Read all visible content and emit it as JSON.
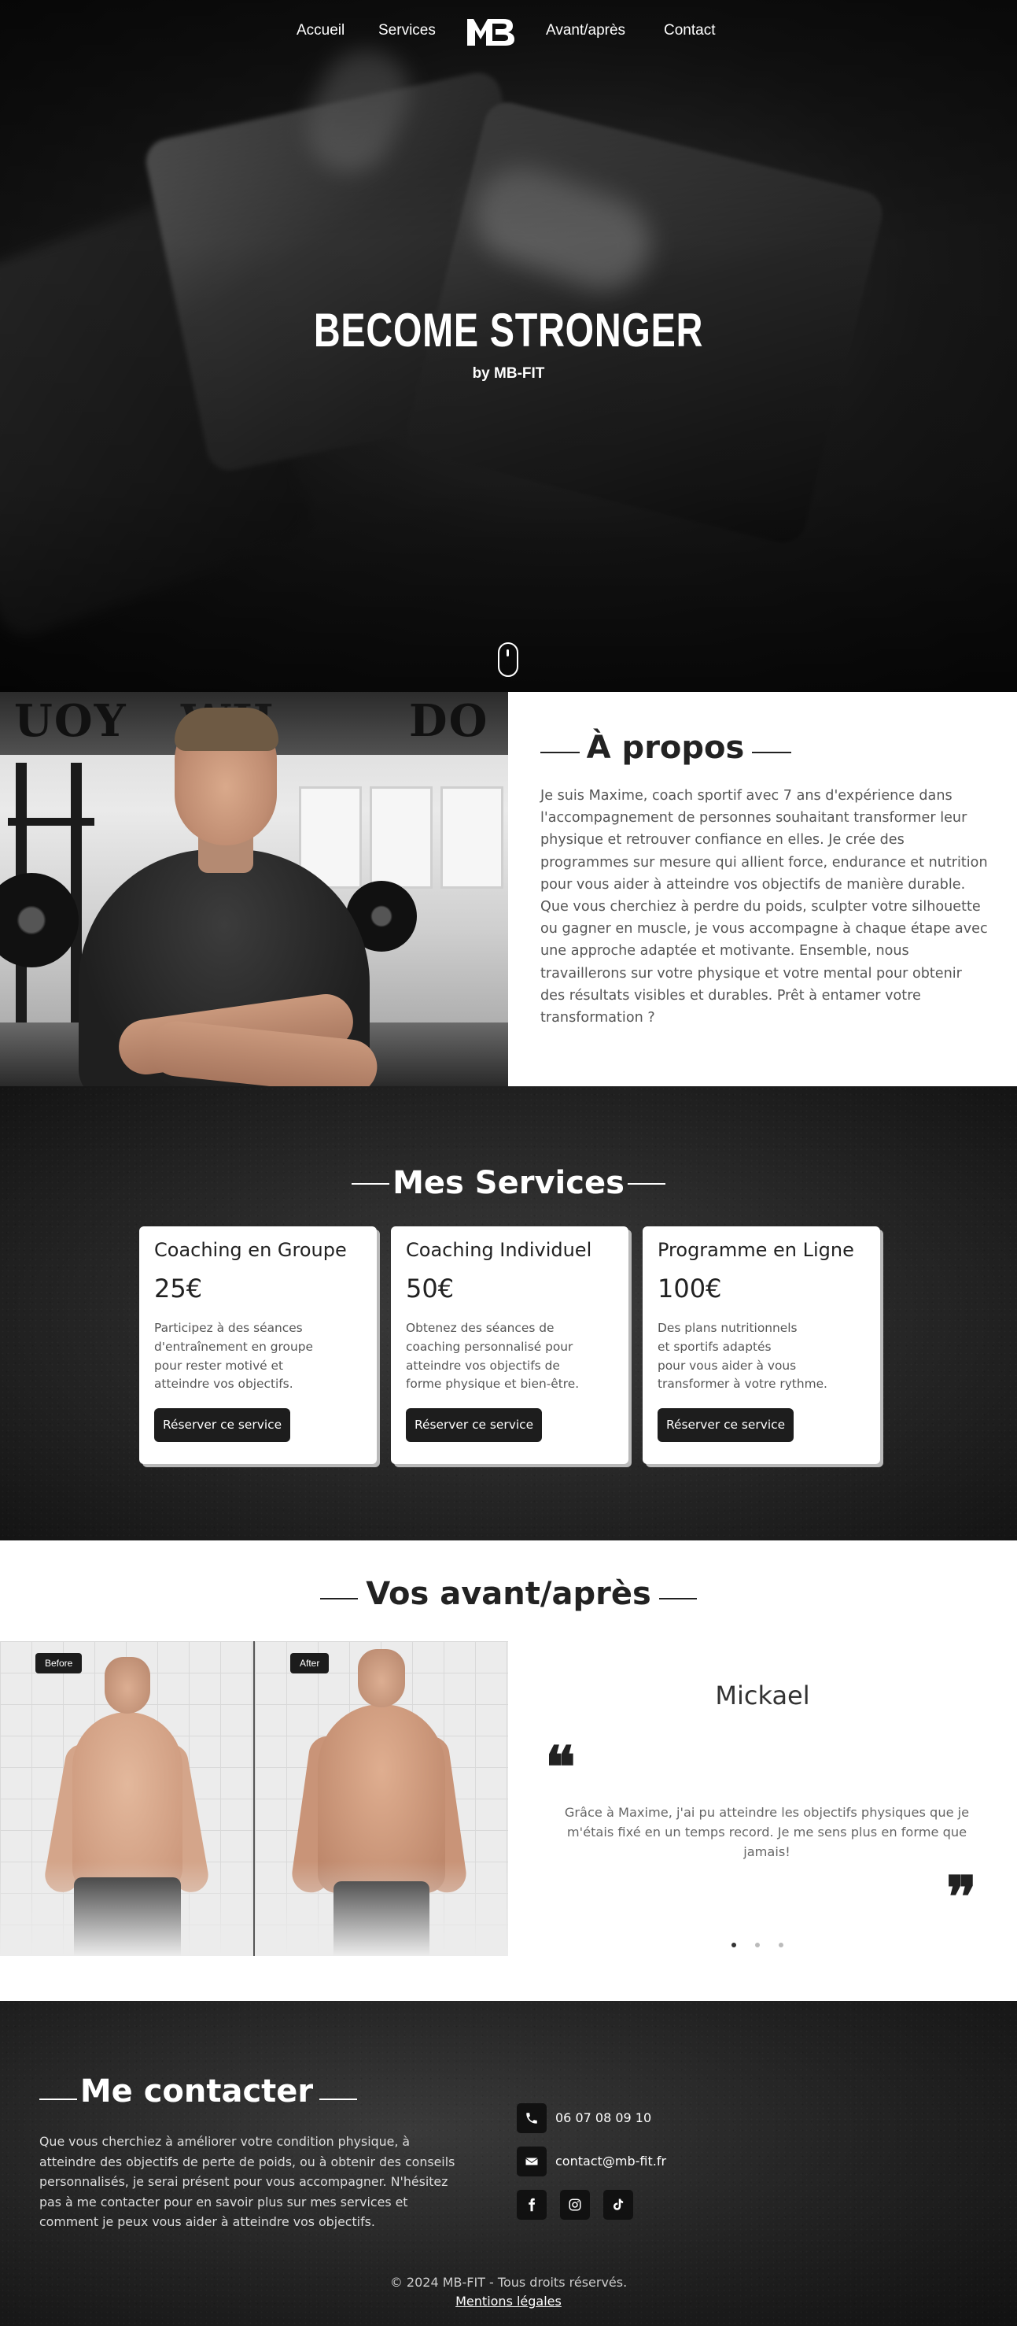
{
  "nav": {
    "items": [
      "Accueil",
      "Services",
      "Avant/après",
      "Contact"
    ],
    "logo_text": "MB"
  },
  "hero": {
    "title": "BECOME STRONGER",
    "subtitle": "by MB-FIT"
  },
  "about": {
    "title": "À propos",
    "text": "Je suis Maxime, coach sportif avec 7 ans d'expérience dans l'accompagnement de personnes souhaitant transformer leur physique et retrouver confiance en elles. Je crée des programmes sur mesure qui allient force, endurance et nutrition pour vous aider à atteindre vos objectifs de manière durable. Que vous cherchiez à perdre du poids, sculpter votre silhouette ou gagner en muscle, je vous accompagne à chaque étape avec une approche adaptée et motivante. Ensemble, nous travaillerons sur votre physique et votre mental pour obtenir des résultats visibles et durables. Prêt à entamer votre transformation ?",
    "photo_text": [
      "UOY",
      "DO",
      "WH"
    ]
  },
  "services": {
    "title": "Mes Services",
    "cards": [
      {
        "title": "Coaching en Groupe",
        "price": "25€",
        "description": "Participez à des séances\nd'entraînement en groupe\npour rester motivé et\natteindre vos objectifs.",
        "button": "Réserver ce service"
      },
      {
        "title": "Coaching Individuel",
        "price": "50€",
        "description": "Obtenez des séances de\ncoaching personnalisé pour\natteindre vos objectifs de\nforme physique et bien-être.",
        "button": "Réserver ce service"
      },
      {
        "title": "Programme en Ligne",
        "price": "100€",
        "description": "Des plans nutritionnels\net sportifs adaptés\npour vous aider à vous\ntransformer à votre rythme.",
        "button": "Réserver ce service"
      }
    ]
  },
  "before_after": {
    "title": "Vos avant/après",
    "before_label": "Before",
    "after_label": "After",
    "testimonial": {
      "name": "Mickael",
      "text": "Grâce à Maxime, j'ai pu atteindre les objectifs physiques que je m'étais fixé en un temps record. Je me sens plus en forme que jamais!",
      "open_quote": "❝",
      "close_quote": "❞"
    },
    "carousel": {
      "count": 3,
      "active": 0
    }
  },
  "contact": {
    "title": "Me contacter",
    "text": "Que vous cherchiez à améliorer votre condition physique, à atteindre des objectifs de perte de poids, ou à obtenir des conseils personnalisés, je serai présent pour vous accompagner. N'hésitez pas à me contacter pour en savoir plus sur mes services et comment je peux vous aider à atteindre vos objectifs.",
    "phone": "06 07 08 09 10",
    "email": "contact@mb-fit.fr",
    "socials": [
      "facebook-icon",
      "instagram-icon",
      "tiktok-icon"
    ]
  },
  "footer": {
    "copyright": "© 2024 MB-FIT - Tous droits réservés.",
    "legal": "Mentions légales"
  },
  "colors": {
    "dark": "#1d1d1d",
    "text_gray": "#555555",
    "white": "#ffffff"
  }
}
